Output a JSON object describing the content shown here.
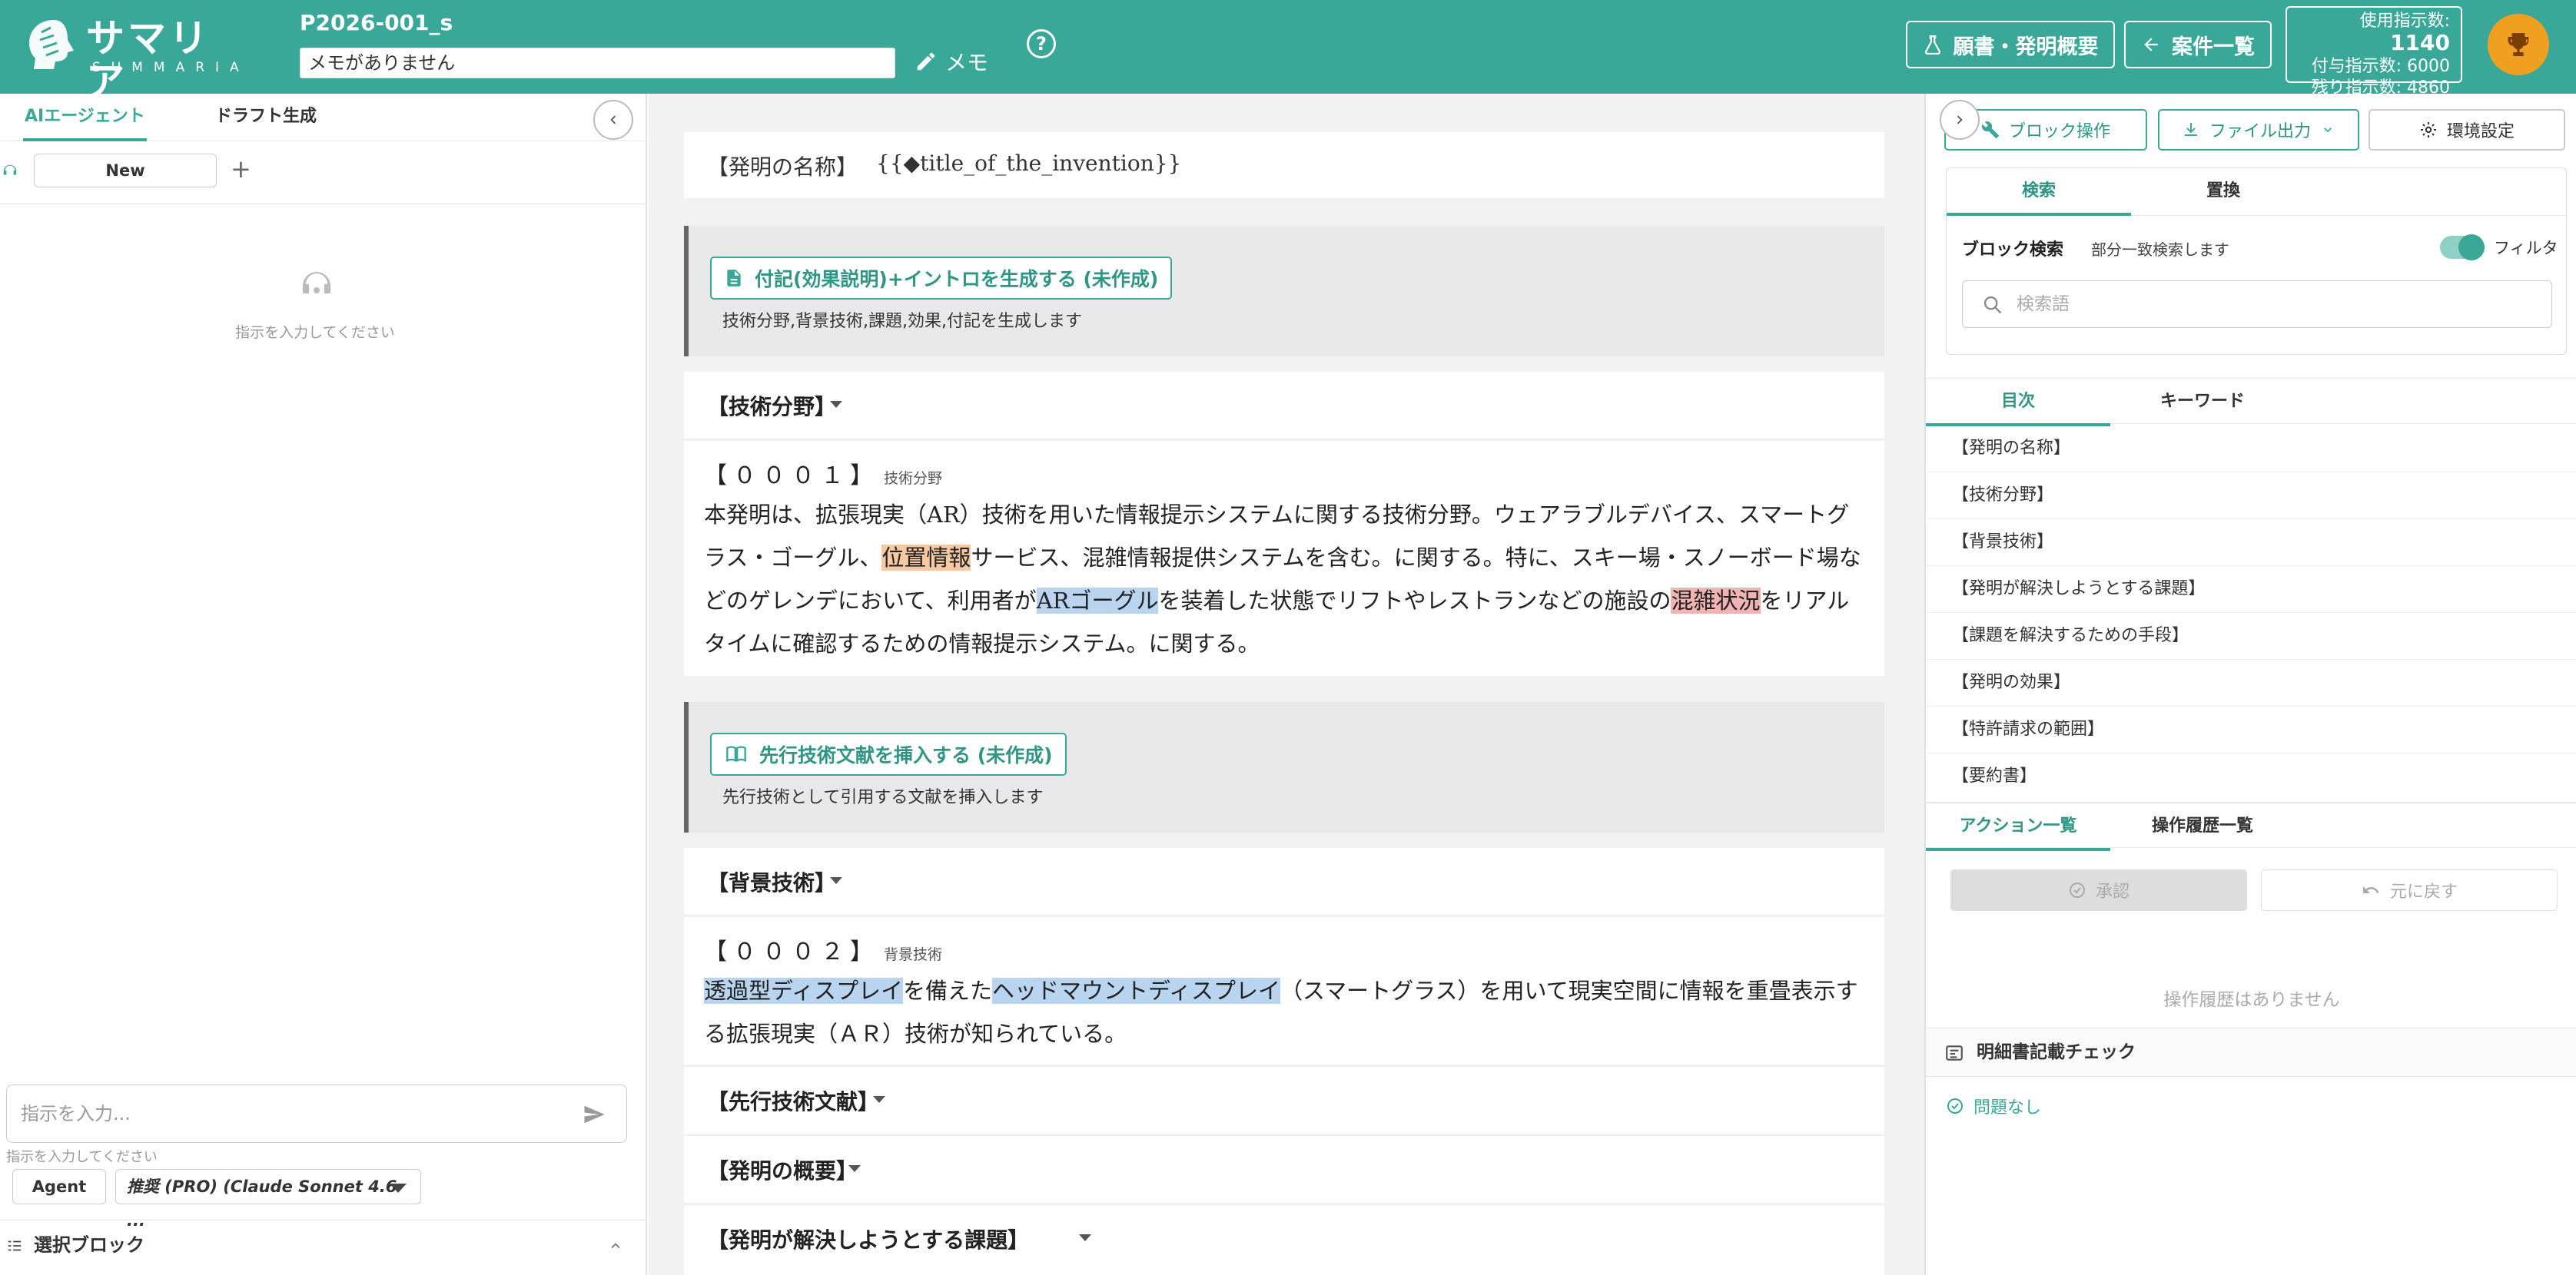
{
  "header": {
    "logo_jp": "サマリア",
    "logo_en": "SUMMARIA",
    "project_title": "P2026-001_s",
    "memo_value": "メモがありません",
    "memo_label": "メモ",
    "help": "?",
    "overview_button": "願書・発明概要",
    "cases_button": "案件一覧",
    "usage_used_label": "使用指示数:",
    "usage_used": "1140",
    "usage_granted": "付与指示数: 6000",
    "usage_remaining": "残り指示数: 4860"
  },
  "left": {
    "tabs": [
      "AIエージェント",
      "ドラフト生成"
    ],
    "new_session": "New",
    "add": "+",
    "empty_message": "指示を入力してください",
    "input_placeholder": "指示を入力...",
    "input_hint": "指示を入力してください",
    "agent_button": "Agent",
    "model_select": "推奨 (PRO) (Claude Sonnet 4.6 ...",
    "selected_block": "選択ブロック"
  },
  "center": {
    "invention_title_label": "【発明の名称】",
    "invention_title_value": "{{◆title_of_the_invention}}",
    "gen1_button": "付記(効果説明)+イントロを生成する (未作成)",
    "gen1_desc": "技術分野,背景技術,課題,効果,付記を生成します",
    "sec_tech": "【技術分野】",
    "para1_num": "【０００１】",
    "para1_tag": "技術分野",
    "para1": {
      "t1": "本発明は、拡張現実（AR）技術を用いた情報提示システムに関する技術分野。ウェアラブルデバイス、スマートグラス・ゴーグル、",
      "h1": "位置情報",
      "t2": "サービス、混雑情報提供システムを含む。に関する。特に、スキー場・スノーボード場などのゲレンデにおいて、利用者が",
      "h2": "ARゴーグル",
      "t3": "を装着した状態でリフトやレストランなどの施設の",
      "h3": "混雑状況",
      "t4": "をリアルタイムに確認するための情報提示システム。に関する。"
    },
    "gen2_button": "先行技術文献を挿入する (未作成)",
    "gen2_desc": "先行技術として引用する文献を挿入します",
    "sec_bg": "【背景技術】",
    "para2_num": "【０００２】",
    "para2_tag": "背景技術",
    "para2": {
      "h1": "透過型ディスプレイ",
      "t1": "を備えた",
      "h2": "ヘッドマウントディスプレイ",
      "t2": "（スマートグラス）を用いて現実空間に情報を重畳表示する拡張現実（ＡＲ）技術が知られている。"
    },
    "sec_prior": "【先行技術文献】",
    "sec_summary": "【発明の概要】",
    "sec_problem": "【発明が解決しようとする課題】"
  },
  "right": {
    "block_ops": "ブロック操作",
    "file_output": "ファイル出力",
    "env_settings": "環境設定",
    "search_tabs": [
      "検索",
      "置換"
    ],
    "block_search_label": "ブロック検索",
    "block_search_desc": "部分一致検索します",
    "filter_label": "フィルタ",
    "search_placeholder": "検索語",
    "toc_tabs": [
      "目次",
      "キーワード"
    ],
    "toc_items": [
      "【発明の名称】",
      "【技術分野】",
      "【背景技術】",
      "【発明が解決しようとする課題】",
      "【課題を解決するための手段】",
      "【発明の効果】",
      "【特許請求の範囲】",
      "【要約書】"
    ],
    "action_tabs": [
      "アクション一覧",
      "操作履歴一覧"
    ],
    "approve": "承認",
    "undo": "元に戻す",
    "no_history": "操作履歴はありません",
    "check_title": "明細書記載チェック",
    "check_ok": "問題なし"
  },
  "colors": {
    "brand": "#3aa898",
    "highlight_orange": "#f6c9a3",
    "highlight_blue": "#b8d4ee",
    "highlight_red": "#f2b3b3",
    "trophy": "#f0a020"
  }
}
